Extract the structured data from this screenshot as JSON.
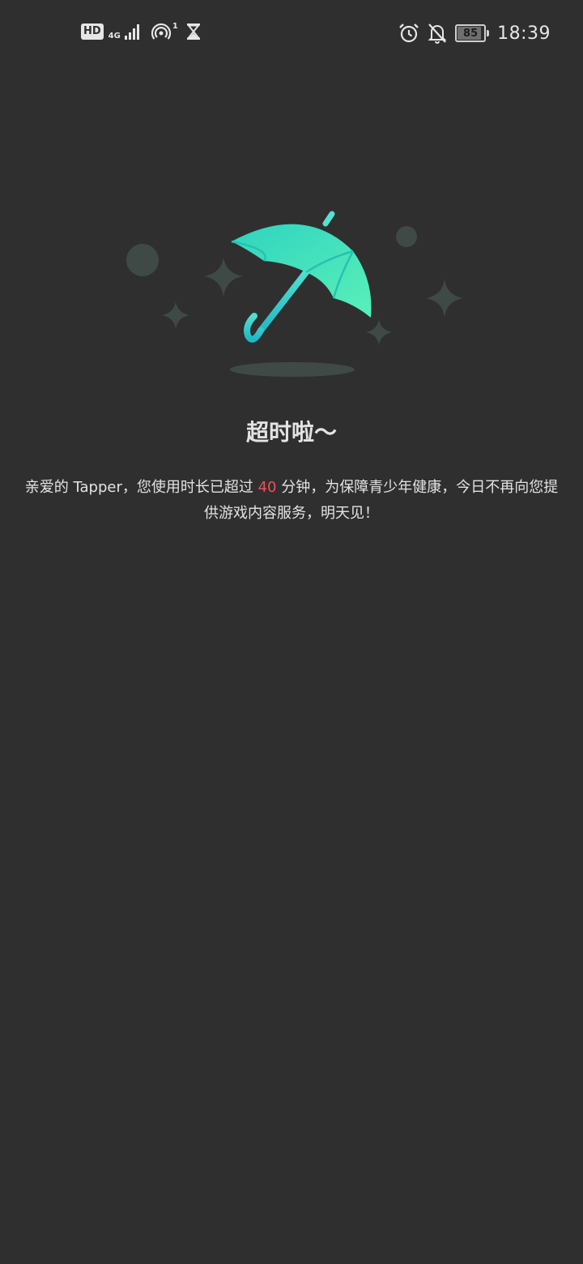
{
  "status_bar": {
    "hd_label": "HD",
    "network_label": "4G",
    "hotspot_count": "1",
    "battery_level": "85",
    "time": "18:39"
  },
  "content": {
    "title": "超时啦～",
    "message_prefix": "亲爱的 Tapper，您使用时长已超过 ",
    "minutes": "40",
    "message_suffix": " 分钟，为保障青少年健康，今日不再向您提供游戏内容服务，明天见！"
  },
  "colors": {
    "background": "#2f2f2f",
    "umbrella_primary": "#37e0c8",
    "highlight": "#f0505b",
    "sparkle": "#3f4a47"
  }
}
